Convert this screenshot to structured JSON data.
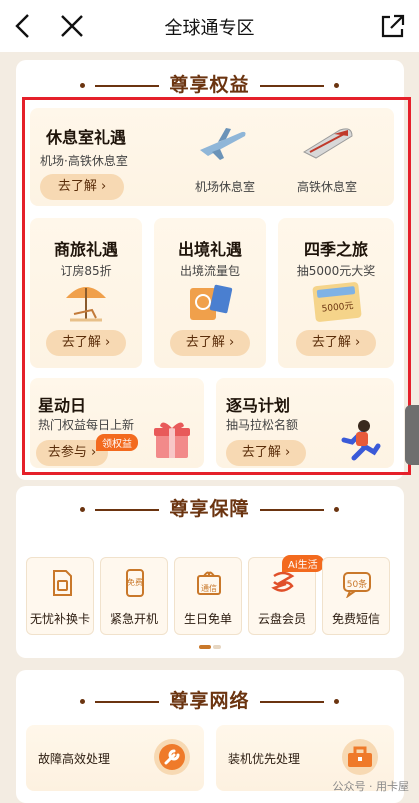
{
  "header": {
    "title": "全球通专区"
  },
  "benefits": {
    "title": "尊享权益",
    "lounge": {
      "title": "休息室礼遇",
      "subtitle": "机场·高铁休息室",
      "button": "去了解 ›",
      "airport": "机场休息室",
      "rail": "高铁休息室"
    },
    "business": {
      "title": "商旅礼遇",
      "subtitle": "订房85折",
      "button": "去了解 ›"
    },
    "outbound": {
      "title": "出境礼遇",
      "subtitle": "出境流量包",
      "button": "去了解 ›"
    },
    "seasons": {
      "title": "四季之旅",
      "subtitle": "抽5000元大奖",
      "button": "去了解 ›",
      "ticket": "5000元"
    },
    "star_day": {
      "title": "星动日",
      "subtitle": "热门权益每日上新",
      "button": "去参与 ›",
      "tag": "领权益"
    },
    "marathon": {
      "title": "逐马计划",
      "subtitle": "抽马拉松名额",
      "button": "去了解 ›"
    }
  },
  "guarantee": {
    "title": "尊享保障",
    "items": [
      {
        "label": "无忧补换卡",
        "icon": "sim-card-icon"
      },
      {
        "label": "紧急开机",
        "icon": "phone-free-icon",
        "icon_text": "免费"
      },
      {
        "label": "生日免单",
        "icon": "gift-box-icon",
        "icon_text": "通信"
      },
      {
        "label": "云盘会员",
        "icon": "cloud-drive-icon",
        "tag": "Ai生活"
      },
      {
        "label": "免费短信",
        "icon": "sms-icon",
        "icon_text": "50条"
      }
    ]
  },
  "network": {
    "title": "尊享网络",
    "items": [
      {
        "label": "故障高效处理",
        "icon": "wrench-icon"
      },
      {
        "label": "装机优先处理",
        "icon": "toolbox-icon"
      }
    ]
  },
  "watermark": "公众号 · 用卡屋",
  "colors": {
    "accent": "#6b3410",
    "button_bg": "#f7d9b3",
    "highlight": "#e5202a",
    "tag": "#f36a1e"
  }
}
